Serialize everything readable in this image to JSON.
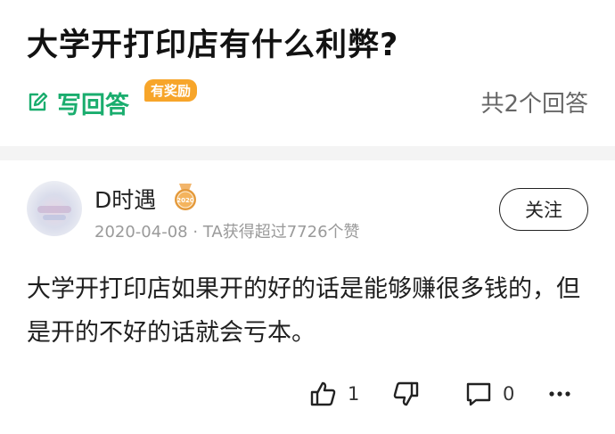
{
  "question": {
    "title": "大学开打印店有什么利弊?"
  },
  "answer_bar": {
    "write_label": "写回答",
    "reward_badge": "有奖励",
    "answer_count": "共2个回答"
  },
  "answer": {
    "author": "D时遇",
    "medal_text": "2020",
    "date": "2020-04-08",
    "separator": "·",
    "likes_info": "TA获得超过7726个赞",
    "follow_label": "关注",
    "content": "大学开打印店如果开的好的话是能够赚很多钱的，但是开的不好的话就会亏本。",
    "like_count": "1",
    "comment_count": "0"
  },
  "colors": {
    "accent_green": "#1aad6e",
    "badge_orange": "#f7a52a"
  },
  "icons": [
    "edit-icon",
    "medal-icon",
    "thumbs-up-icon",
    "thumbs-down-icon",
    "comment-icon",
    "more-icon"
  ]
}
